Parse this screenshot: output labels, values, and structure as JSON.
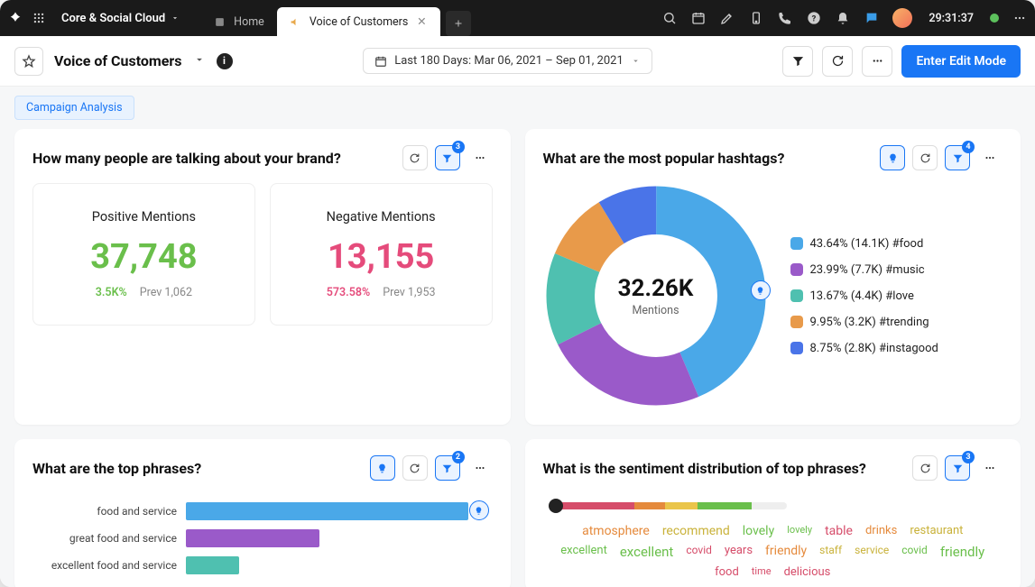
{
  "nav": {
    "workspace": "Core & Social Cloud",
    "tabs": [
      {
        "label": "Home",
        "active": false
      },
      {
        "label": "Voice of Customers",
        "active": true
      }
    ],
    "time": "29:31:37"
  },
  "header": {
    "title": "Voice of Customers",
    "date_range": "Last 180 Days: Mar 06, 2021 – Sep 01, 2021",
    "edit_btn": "Enter Edit Mode"
  },
  "sub": {
    "chip": "Campaign Analysis"
  },
  "cards": {
    "mentions": {
      "title": "How many people are talking about your brand?",
      "filter_badge": "3",
      "positive": {
        "label": "Positive Mentions",
        "value": "37,748",
        "delta": "3.5K%",
        "prev": "Prev 1,062"
      },
      "negative": {
        "label": "Negative Mentions",
        "value": "13,155",
        "delta": "573.58%",
        "prev": "Prev 1,953"
      }
    },
    "hashtags": {
      "title": "What are the most popular hashtags?",
      "filter_badge": "4",
      "total": "32.26K",
      "sub": "Mentions",
      "legend": [
        {
          "label": "43.64% (14.1K) #food",
          "color": "#4aa8e8"
        },
        {
          "label": "23.99% (7.7K) #music",
          "color": "#9a5ac9"
        },
        {
          "label": "13.67% (4.4K) #love",
          "color": "#4fc0b0"
        },
        {
          "label": "9.95% (3.2K) #trending",
          "color": "#e89a4a"
        },
        {
          "label": "8.75% (2.8K) #instagood",
          "color": "#4a74e8"
        }
      ]
    },
    "phrases": {
      "title": "What are the top phrases?",
      "filter_badge": "2",
      "rows": [
        {
          "label": "food and service",
          "color": "#4aa8e8",
          "pct": 95
        },
        {
          "label": "great food and service",
          "color": "#9a5ac9",
          "pct": 45
        },
        {
          "label": "excellent food and service",
          "color": "#4fc0b0",
          "pct": 18
        }
      ]
    },
    "sentiment": {
      "title": "What is the sentiment distribution of top phrases?",
      "filter_badge": "3",
      "words": [
        {
          "t": "atmosphere",
          "c": "#e58a3c",
          "s": 14
        },
        {
          "t": "recommend",
          "c": "#c9b23a",
          "s": 14
        },
        {
          "t": "lovely",
          "c": "#6abf4b",
          "s": 14
        },
        {
          "t": "lovely",
          "c": "#6abf4b",
          "s": 11
        },
        {
          "t": "table",
          "c": "#d64d6a",
          "s": 14
        },
        {
          "t": "drinks",
          "c": "#e58a3c",
          "s": 13
        },
        {
          "t": "restaurant",
          "c": "#c9b23a",
          "s": 13
        },
        {
          "t": "excellent",
          "c": "#6abf4b",
          "s": 13
        },
        {
          "t": "excellent",
          "c": "#6abf4b",
          "s": 15
        },
        {
          "t": "covid",
          "c": "#d64d6a",
          "s": 12
        },
        {
          "t": "years",
          "c": "#d64d6a",
          "s": 13
        },
        {
          "t": "friendly",
          "c": "#e58a3c",
          "s": 14
        },
        {
          "t": "staff",
          "c": "#c9b23a",
          "s": 12
        },
        {
          "t": "service",
          "c": "#c9b23a",
          "s": 12
        },
        {
          "t": "covid",
          "c": "#6abf4b",
          "s": 12
        },
        {
          "t": "friendly",
          "c": "#6abf4b",
          "s": 15
        },
        {
          "t": "food",
          "c": "#d64d6a",
          "s": 13
        },
        {
          "t": "time",
          "c": "#d64d6a",
          "s": 11
        },
        {
          "t": "delicious",
          "c": "#d64d6a",
          "s": 13
        }
      ]
    }
  },
  "chart_data": [
    {
      "type": "bar",
      "title": "How many people are talking about your brand?",
      "categories": [
        "Positive Mentions",
        "Negative Mentions"
      ],
      "values": [
        37748,
        13155
      ],
      "deltas_pct": [
        3500,
        573.58
      ],
      "previous": [
        1062,
        1953
      ]
    },
    {
      "type": "pie",
      "title": "What are the most popular hashtags?",
      "total": 32260,
      "series": [
        {
          "name": "#food",
          "pct": 43.64,
          "count": 14100
        },
        {
          "name": "#music",
          "pct": 23.99,
          "count": 7700
        },
        {
          "name": "#love",
          "pct": 13.67,
          "count": 4400
        },
        {
          "name": "#trending",
          "pct": 9.95,
          "count": 3200
        },
        {
          "name": "#instagood",
          "pct": 8.75,
          "count": 2800
        }
      ]
    },
    {
      "type": "bar",
      "title": "What are the top phrases?",
      "categories": [
        "food and service",
        "great food and service",
        "excellent food and service"
      ],
      "values": [
        95,
        45,
        18
      ]
    }
  ]
}
